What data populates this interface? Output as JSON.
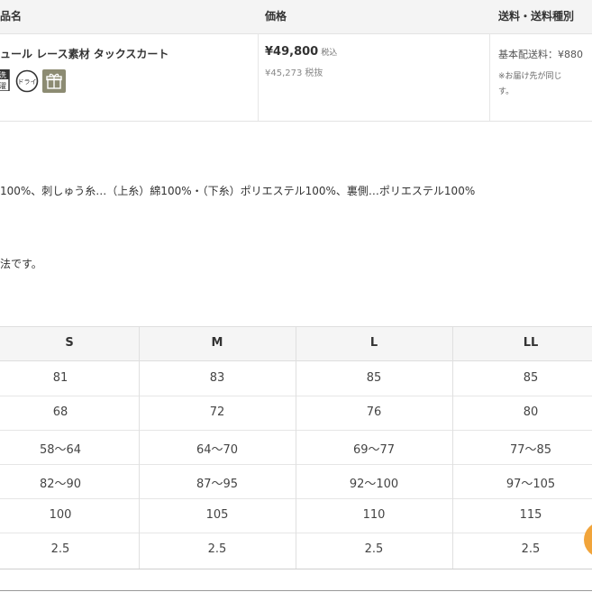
{
  "product_table": {
    "headers": {
      "name": "品名",
      "price": "価格",
      "shipping": "送料・送料種別"
    },
    "product_name": "ュール レース素材 タックスカート",
    "icons": [
      {
        "name": "care-label-icon",
        "text": "洗\n濯"
      },
      {
        "name": "dry-clean-icon",
        "text": "ドライ"
      },
      {
        "name": "gift-icon",
        "text": ""
      }
    ],
    "price_tax_in": "¥49,800",
    "price_tax_in_suffix": "税込",
    "price_tax_ex": "¥45,273",
    "price_tax_ex_suffix": "税抜",
    "shipping_fee": "基本配送料：¥880",
    "shipping_note_line1": "※お届け先が同じ",
    "shipping_note_line2": "す。"
  },
  "material_text": "100%、刺しゅう糸…（上糸）綿100%・（下糸）ポリエステル100%、裏側…ポリエステル100%",
  "size_note_text": "法です。",
  "size_table": {
    "headers": [
      "S",
      "M",
      "L",
      "LL"
    ],
    "rows": [
      [
        "81",
        "83",
        "85",
        "85"
      ],
      [
        "68",
        "72",
        "76",
        "80"
      ],
      [
        "58〜64",
        "64〜70",
        "69〜77",
        "77〜85"
      ],
      [
        "82〜90",
        "87〜95",
        "92〜100",
        "97〜105"
      ],
      [
        "100",
        "105",
        "110",
        "115"
      ],
      [
        "2.5",
        "2.5",
        "2.5",
        "2.5"
      ]
    ]
  },
  "colors": {
    "accent_orange": "#f1a43a",
    "header_bg": "#f4f4f4"
  }
}
